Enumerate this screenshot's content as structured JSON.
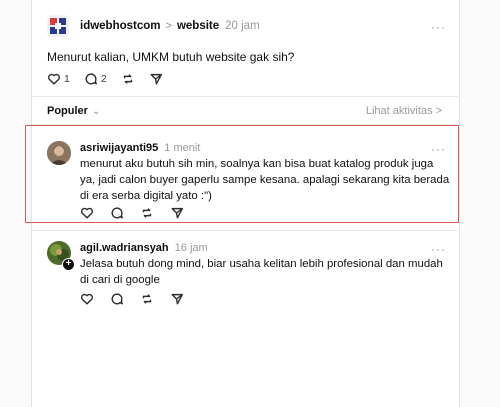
{
  "post": {
    "username": "idwebhostcom",
    "topic": "website",
    "time": "20 jam",
    "more": "···",
    "text": "Menurut kalian, UMKM butuh website gak sih?",
    "likes": "1",
    "replies": "2"
  },
  "sort": {
    "label": "Populer",
    "activity_link": "Lihat aktivitas >"
  },
  "replies": [
    {
      "username": "asriwijayanti95",
      "time": "1 menit",
      "more": "···",
      "text": "menurut aku butuh sih min, soalnya kan bisa buat katalog produk juga ya, jadi calon buyer gaperlu sampe kesana. apalagi sekarang kita berada di era serba digital yato :\")"
    },
    {
      "username": "agil.wadriansyah",
      "time": "16 jam",
      "more": "···",
      "text": "Jelasa butuh dong mind, biar usaha kelitan lebih profesional dan mudah di cari di google"
    }
  ],
  "icons": [
    "heart-icon",
    "comment-icon",
    "repost-icon",
    "share-icon",
    "more-icon",
    "chevron-down-icon"
  ],
  "colors": {
    "highlight": "#e05a5a",
    "text": "#101010",
    "muted": "#9a9a9a"
  }
}
